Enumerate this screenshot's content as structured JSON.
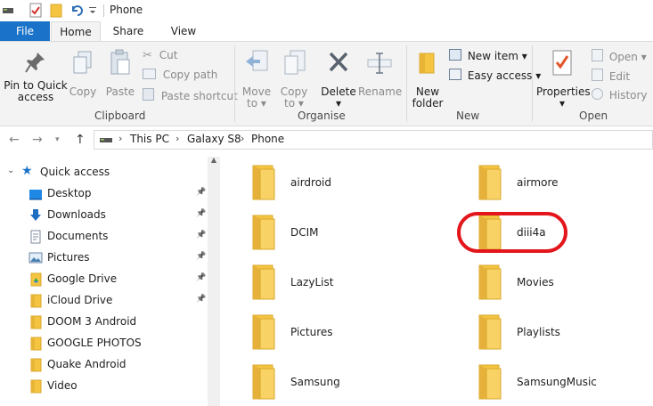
{
  "window": {
    "title": "Phone"
  },
  "tabs": {
    "file": "File",
    "home": "Home",
    "share": "Share",
    "view": "View"
  },
  "ribbon": {
    "clipboard": {
      "label": "Clipboard",
      "pin": "Pin to Quick access",
      "pin_line1": "Pin to Quick",
      "pin_line2": "access",
      "copy": "Copy",
      "paste": "Paste",
      "cut": "Cut",
      "copy_path": "Copy path",
      "paste_shortcut": "Paste shortcut"
    },
    "organise": {
      "label": "Organise",
      "move_to_1": "Move",
      "move_to_2": "to",
      "copy_to_1": "Copy",
      "copy_to_2": "to",
      "delete": "Delete",
      "rename": "Rename"
    },
    "new": {
      "label": "New",
      "new_folder_1": "New",
      "new_folder_2": "folder",
      "new_item": "New item",
      "easy_access": "Easy access"
    },
    "open": {
      "label": "Open",
      "properties": "Properties",
      "open": "Open",
      "edit": "Edit",
      "history": "History"
    }
  },
  "address": {
    "crumbs": [
      "This PC",
      "Galaxy S8",
      "Phone"
    ]
  },
  "nav": {
    "quick_access": "Quick access",
    "items": [
      {
        "label": "Desktop",
        "icon": "desktop-icon",
        "pinned": true
      },
      {
        "label": "Downloads",
        "icon": "downloads-icon",
        "pinned": true
      },
      {
        "label": "Documents",
        "icon": "documents-icon",
        "pinned": true
      },
      {
        "label": "Pictures",
        "icon": "pictures-icon",
        "pinned": true
      },
      {
        "label": "Google Drive",
        "icon": "google-drive-icon",
        "pinned": true
      },
      {
        "label": "iCloud Drive",
        "icon": "folder-icon",
        "pinned": true
      },
      {
        "label": "DOOM 3 Android",
        "icon": "folder-icon",
        "pinned": false
      },
      {
        "label": "GOOGLE PHOTOS",
        "icon": "folder-icon",
        "pinned": false
      },
      {
        "label": "Quake Android",
        "icon": "folder-icon",
        "pinned": false
      },
      {
        "label": "Video",
        "icon": "folder-icon",
        "pinned": false
      }
    ]
  },
  "folders": [
    "airdroid",
    "airmore",
    "DCIM",
    "diii4a",
    "LazyList",
    "Movies",
    "Pictures",
    "Playlists",
    "Samsung",
    "SamsungMusic"
  ],
  "colors": {
    "accent": "#1a73c8",
    "highlight": "#e3161c",
    "folder": "#f5c542"
  }
}
